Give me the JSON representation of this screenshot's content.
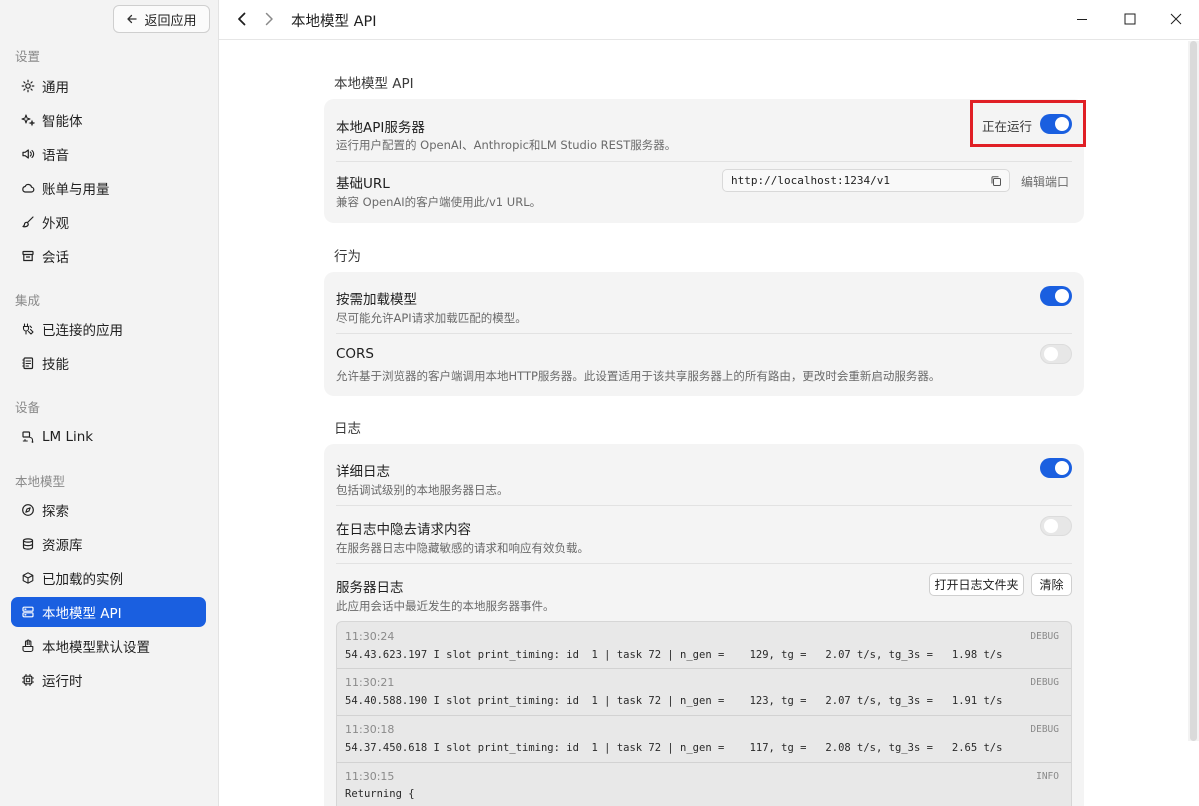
{
  "sidebar": {
    "back_label": "返回应用",
    "sections": [
      {
        "label": "设置"
      },
      {
        "label": "集成"
      },
      {
        "label": "设备"
      },
      {
        "label": "本地模型"
      }
    ],
    "items": [
      {
        "label": "通用",
        "icon": "gear-icon"
      },
      {
        "label": "智能体",
        "icon": "sparkle-icon"
      },
      {
        "label": "语音",
        "icon": "speaker-icon"
      },
      {
        "label": "账单与用量",
        "icon": "cloud-icon"
      },
      {
        "label": "外观",
        "icon": "brush-icon"
      },
      {
        "label": "会话",
        "icon": "archive-icon"
      },
      {
        "label": "已连接的应用",
        "icon": "plug-icon"
      },
      {
        "label": "技能",
        "icon": "note-icon"
      },
      {
        "label": "LM Link",
        "icon": "link-devices-icon"
      },
      {
        "label": "探索",
        "icon": "compass-icon"
      },
      {
        "label": "资源库",
        "icon": "database-icon"
      },
      {
        "label": "已加载的实例",
        "icon": "cube-icon"
      },
      {
        "label": "本地模型 API",
        "icon": "server-icon",
        "active": true
      },
      {
        "label": "本地模型默认设置",
        "icon": "hand-icon"
      },
      {
        "label": "运行时",
        "icon": "chip-icon"
      }
    ]
  },
  "header": {
    "title": "本地模型 API"
  },
  "groups": {
    "api": {
      "title": "本地模型 API",
      "server": {
        "title": "本地API服务器",
        "desc": "运行用户配置的 OpenAI、Anthropic和LM Studio REST服务器。",
        "status": "正在运行",
        "enabled": true
      },
      "base_url": {
        "title": "基础URL",
        "desc": "兼容 OpenAI的客户端使用此/v1 URL。",
        "value": "http://localhost:1234/v1",
        "edit_port": "编辑端口"
      }
    },
    "behavior": {
      "title": "行为",
      "load_on_demand": {
        "title": "按需加载模型",
        "desc": "尽可能允许API请求加载匹配的模型。",
        "enabled": true
      },
      "cors": {
        "title": "CORS",
        "desc": "允许基于浏览器的客户端调用本地HTTP服务器。此设置适用于该共享服务器上的所有路由，更改时会重新启动服务器。",
        "enabled": false
      }
    },
    "logs": {
      "title": "日志",
      "verbose": {
        "title": "详细日志",
        "desc": "包括调试级别的本地服务器日志。",
        "enabled": true
      },
      "redact": {
        "title": "在日志中隐去请求内容",
        "desc": "在服务器日志中隐藏敏感的请求和响应有效负载。",
        "enabled": false
      },
      "server_logs": {
        "title": "服务器日志",
        "desc": "此应用会话中最近发生的本地服务器事件。",
        "open_folder": "打开日志文件夹",
        "clear": "清除"
      },
      "entries": [
        {
          "time": "11:30:24",
          "level": "DEBUG",
          "msg": "54.43.623.197 I slot print_timing: id  1 | task 72 | n_gen =    129, tg =   2.07 t/s, tg_3s =   1.98 t/s"
        },
        {
          "time": "11:30:21",
          "level": "DEBUG",
          "msg": "54.40.588.190 I slot print_timing: id  1 | task 72 | n_gen =    123, tg =   2.07 t/s, tg_3s =   1.91 t/s"
        },
        {
          "time": "11:30:18",
          "level": "DEBUG",
          "msg": "54.37.450.618 I slot print_timing: id  1 | task 72 | n_gen =    117, tg =   2.08 t/s, tg_3s =   2.65 t/s"
        },
        {
          "time": "11:30:15",
          "level": "INFO",
          "msg": "Returning {"
        }
      ]
    }
  }
}
